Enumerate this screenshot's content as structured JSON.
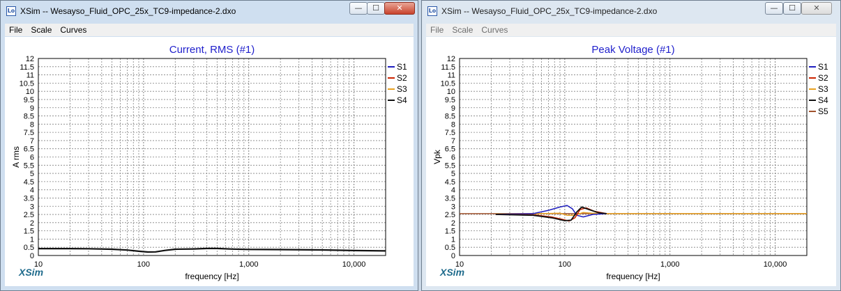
{
  "windows": [
    {
      "title": "XSim -- Wesayso_Fluid_OPC_25x_TC9-impedance-2.dxo",
      "menu": [
        "File",
        "Scale",
        "Curves"
      ],
      "brand": "XSim",
      "controls": {
        "minimize": "—",
        "maximize": "☐",
        "close": "✕"
      }
    },
    {
      "title": "XSim -- Wesayso_Fluid_OPC_25x_TC9-impedance-2.dxo",
      "menu": [
        "File",
        "Scale",
        "Curves"
      ],
      "brand": "XSim",
      "controls": {
        "minimize": "—",
        "maximize": "☐",
        "close": "✕"
      }
    }
  ],
  "chart_data": [
    {
      "type": "line",
      "title": "Current, RMS (#1)",
      "xlabel": "frequency [Hz]",
      "ylabel": "A rms",
      "xscale": "log",
      "xlim": [
        10,
        20000
      ],
      "ylim": [
        0,
        12
      ],
      "x_ticks": [
        10,
        100,
        1000,
        10000
      ],
      "x_tick_labels": [
        "10",
        "100",
        "1,000",
        "10,000"
      ],
      "y_ticks": [
        0,
        0.5,
        1,
        1.5,
        2,
        2.5,
        3,
        3.5,
        4,
        4.5,
        5,
        5.5,
        6,
        6.5,
        7,
        7.5,
        8,
        8.5,
        9,
        9.5,
        10,
        10.5,
        11,
        11.5,
        12
      ],
      "y_tick_labels": [
        "0",
        "0.5",
        "1",
        "1.5",
        "2",
        "2.5",
        "3",
        "3.5",
        "4",
        "4.5",
        "5",
        "5.5",
        "6",
        "6.5",
        "7",
        "7.5",
        "8",
        "8.5",
        "9",
        "9.5",
        "10",
        "10.5",
        "11",
        "11.5",
        "12"
      ],
      "grid": true,
      "legend_position": "top-right",
      "legend": [
        {
          "name": "S1",
          "color": "#1f1fbf"
        },
        {
          "name": "S2",
          "color": "#cc2200"
        },
        {
          "name": "S3",
          "color": "#e8a020"
        },
        {
          "name": "S4",
          "color": "#111111"
        }
      ],
      "series": [
        {
          "name": "S4",
          "color": "#111111",
          "width": 2.2,
          "points": [
            [
              10,
              0.42
            ],
            [
              20,
              0.42
            ],
            [
              30,
              0.41
            ],
            [
              50,
              0.38
            ],
            [
              70,
              0.33
            ],
            [
              90,
              0.26
            ],
            [
              110,
              0.21
            ],
            [
              130,
              0.22
            ],
            [
              160,
              0.31
            ],
            [
              200,
              0.38
            ],
            [
              300,
              0.4
            ],
            [
              400,
              0.43
            ],
            [
              500,
              0.43
            ],
            [
              700,
              0.39
            ],
            [
              1000,
              0.37
            ],
            [
              2000,
              0.36
            ],
            [
              5000,
              0.34
            ],
            [
              10000,
              0.3
            ],
            [
              20000,
              0.28
            ]
          ]
        }
      ]
    },
    {
      "type": "line",
      "title": "Peak Voltage (#1)",
      "xlabel": "frequency [Hz]",
      "ylabel": "Vpk",
      "xscale": "log",
      "xlim": [
        10,
        20000
      ],
      "ylim": [
        0,
        12
      ],
      "x_ticks": [
        10,
        100,
        1000,
        10000
      ],
      "x_tick_labels": [
        "10",
        "100",
        "1,000",
        "10,000"
      ],
      "y_ticks": [
        0,
        0.5,
        1,
        1.5,
        2,
        2.5,
        3,
        3.5,
        4,
        4.5,
        5,
        5.5,
        6,
        6.5,
        7,
        7.5,
        8,
        8.5,
        9,
        9.5,
        10,
        10.5,
        11,
        11.5,
        12
      ],
      "y_tick_labels": [
        "0",
        "0.5",
        "1",
        "1.5",
        "2",
        "2.5",
        "3",
        "3.5",
        "4",
        "4.5",
        "5",
        "5.5",
        "6",
        "6.5",
        "7",
        "7.5",
        "8",
        "8.5",
        "9",
        "9.5",
        "10",
        "10.5",
        "11",
        "11.5",
        "12"
      ],
      "grid": true,
      "legend_position": "top-right",
      "legend": [
        {
          "name": "S1",
          "color": "#1f1fbf"
        },
        {
          "name": "S2",
          "color": "#cc2200"
        },
        {
          "name": "S3",
          "color": "#e8a020"
        },
        {
          "name": "S4",
          "color": "#111111"
        },
        {
          "name": "S5",
          "color": "#a0522d"
        }
      ],
      "series": [
        {
          "name": "S5",
          "color": "#a0522d",
          "width": 1.5,
          "points": [
            [
              10,
              2.55
            ],
            [
              20000,
              2.55
            ]
          ]
        },
        {
          "name": "S3",
          "color": "#e8a020",
          "width": 1.5,
          "points": [
            [
              22,
              2.55
            ],
            [
              60,
              2.55
            ],
            [
              90,
              2.58
            ],
            [
              105,
              2.45
            ],
            [
              125,
              2.45
            ],
            [
              150,
              2.62
            ],
            [
              180,
              2.58
            ],
            [
              250,
              2.55
            ],
            [
              20000,
              2.55
            ]
          ]
        },
        {
          "name": "S1",
          "color": "#1f1fbf",
          "width": 1.5,
          "points": [
            [
              22,
              2.52
            ],
            [
              50,
              2.55
            ],
            [
              70,
              2.75
            ],
            [
              90,
              2.95
            ],
            [
              105,
              3.05
            ],
            [
              118,
              2.85
            ],
            [
              130,
              2.45
            ],
            [
              150,
              2.35
            ],
            [
              185,
              2.5
            ],
            [
              250,
              2.55
            ]
          ]
        },
        {
          "name": "S2",
          "color": "#cc2200",
          "width": 1.5,
          "points": [
            [
              22,
              2.5
            ],
            [
              50,
              2.48
            ],
            [
              75,
              2.35
            ],
            [
              95,
              2.2
            ],
            [
              110,
              2.1
            ],
            [
              125,
              2.3
            ],
            [
              140,
              2.8
            ],
            [
              160,
              2.9
            ],
            [
              190,
              2.7
            ],
            [
              250,
              2.55
            ]
          ]
        },
        {
          "name": "S4",
          "color": "#111111",
          "width": 1.8,
          "points": [
            [
              22,
              2.5
            ],
            [
              50,
              2.45
            ],
            [
              75,
              2.3
            ],
            [
              100,
              2.12
            ],
            [
              115,
              2.15
            ],
            [
              130,
              2.65
            ],
            [
              145,
              2.95
            ],
            [
              170,
              2.8
            ],
            [
              210,
              2.6
            ],
            [
              250,
              2.55
            ]
          ]
        }
      ]
    }
  ]
}
